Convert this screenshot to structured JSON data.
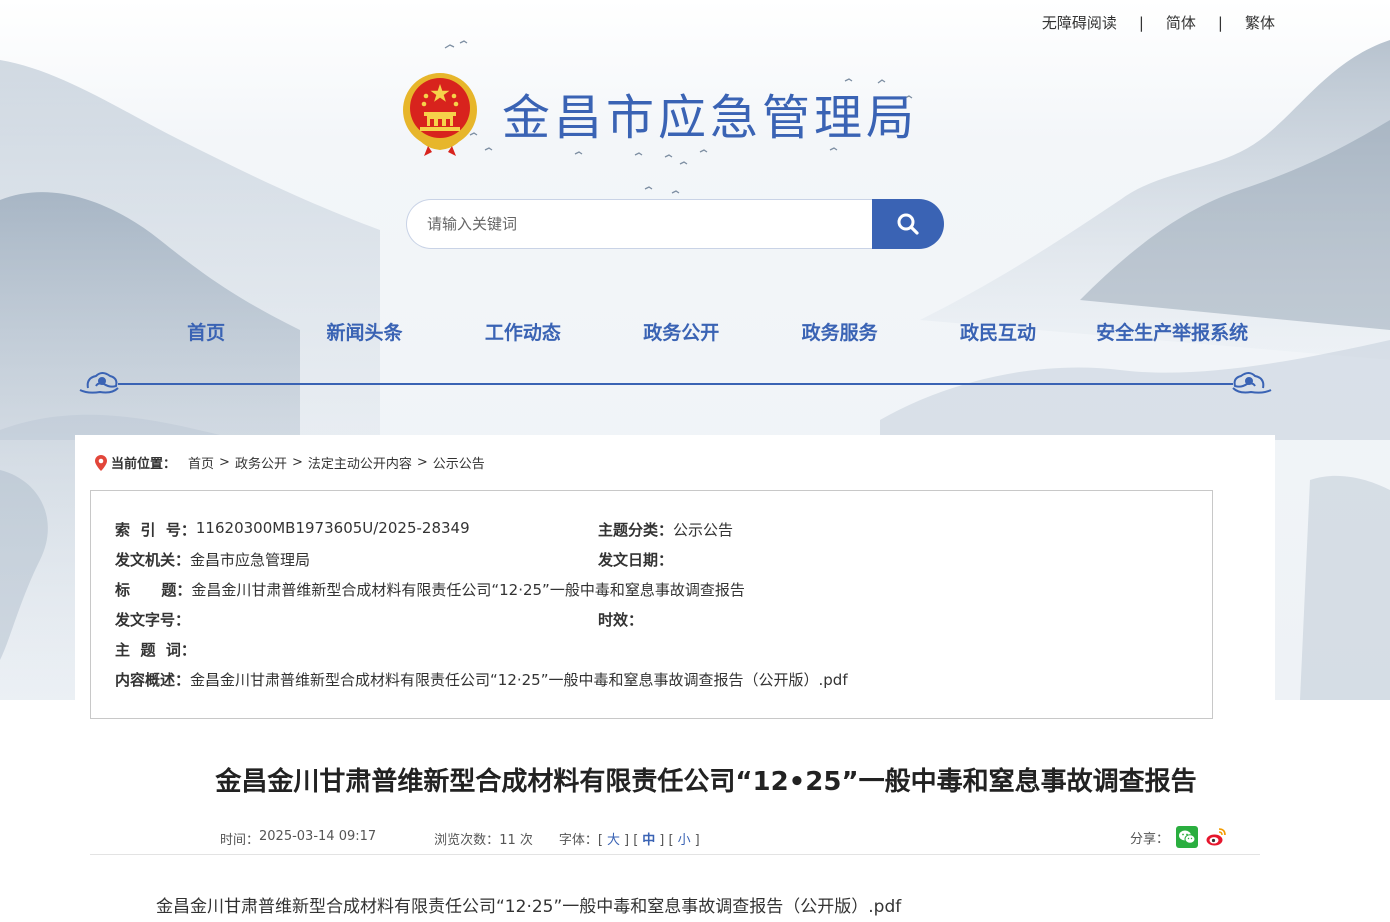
{
  "topbar": {
    "accessible": "无障碍阅读",
    "sep1": "|",
    "simplified": "简体",
    "sep2": "|",
    "traditional": "繁体"
  },
  "header": {
    "site_title": "金昌市应急管理局"
  },
  "search": {
    "placeholder": "请输入关键词"
  },
  "nav": {
    "items": [
      {
        "label": "首页"
      },
      {
        "label": "新闻头条"
      },
      {
        "label": "工作动态"
      },
      {
        "label": "政务公开"
      },
      {
        "label": "政务服务"
      },
      {
        "label": "政民互动"
      },
      {
        "label": "安全生产举报系统"
      }
    ]
  },
  "breadcrumb": {
    "label": "当前位置：",
    "items": [
      "首页",
      "政务公开",
      "法定主动公开内容",
      "公示公告"
    ],
    "sep": ">"
  },
  "meta": {
    "index_key": "索  引  号：",
    "index_val": "11620300MB1973605U/2025-28349",
    "topic_key": "主题分类：",
    "topic_val": "公示公告",
    "issuer_key": "发文机关：",
    "issuer_val": "金昌市应急管理局",
    "date_key": "发文日期：",
    "date_val": "",
    "title_key": "标      题：",
    "title_val": "金昌金川甘肃普维新型合成材料有限责任公司“12·25”一般中毒和窒息事故调查报告",
    "docno_key": "发文字号：",
    "docno_val": "",
    "validity_key": "时效：",
    "validity_val": "",
    "keywords_key": "主  题  词：",
    "keywords_val": "",
    "summary_key": "内容概述：",
    "summary_val": "金昌金川甘肃普维新型合成材料有限责任公司“12·25”一般中毒和窒息事故调查报告（公开版）.pdf"
  },
  "article": {
    "title": "金昌金川甘肃普维新型合成材料有限责任公司“12•25”一般中毒和窒息事故调查报告",
    "time_label": "时间：",
    "time_val": "2025-03-14 09:17",
    "views_label": "浏览次数：",
    "views_val": "11 次",
    "font_label": "字体：",
    "font_large": "大",
    "font_medium": "中",
    "font_small": "小",
    "share_label": "分享：",
    "attachment": "金昌金川甘肃普维新型合成材料有限责任公司“12·25”一般中毒和窒息事故调查报告（公开版）.pdf"
  },
  "colors": {
    "brand": "#3a63b4",
    "wechat": "#2aae3f",
    "weibo": "#e6162d"
  },
  "icons": [
    "national-emblem-icon",
    "search-icon",
    "location-pin-icon",
    "wechat-icon",
    "weibo-icon",
    "cloud-ornament-icon"
  ]
}
